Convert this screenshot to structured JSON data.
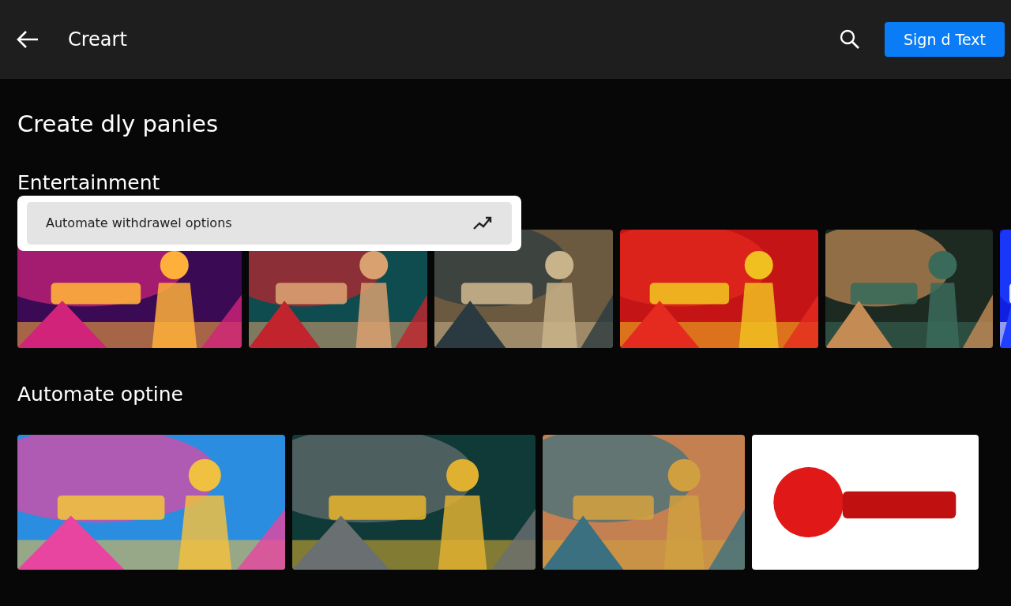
{
  "header": {
    "title": "Creart",
    "action_button": "Sign d Text"
  },
  "page_title": "Create dly panies",
  "sections": [
    {
      "heading": "Entertainment",
      "popup": {
        "label": "Automate withdrawel options"
      }
    },
    {
      "heading": "Automate optine"
    }
  ]
}
